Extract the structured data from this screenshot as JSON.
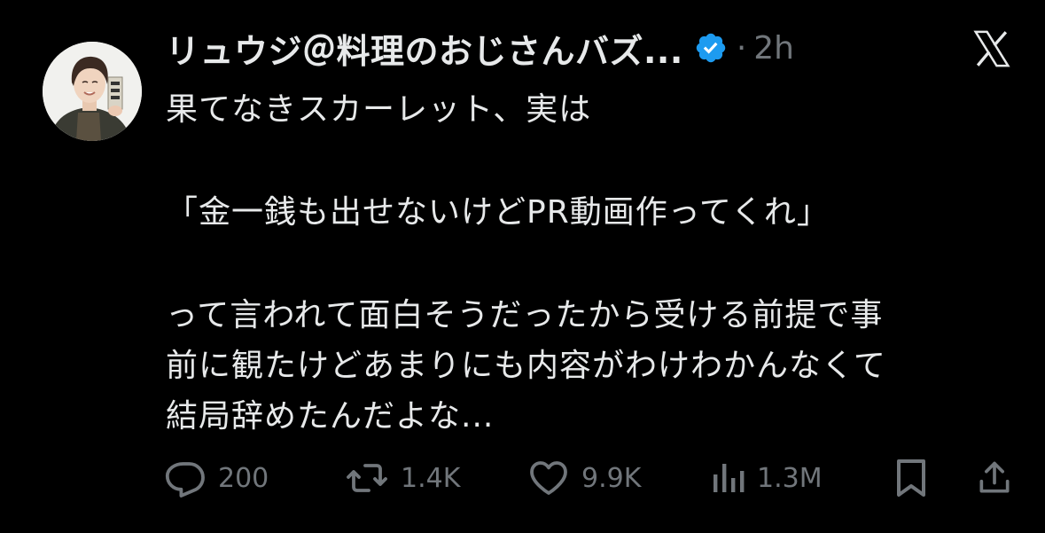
{
  "tweet": {
    "author": {
      "display_name": "リュウジ＠料理のおじさんバズ...",
      "verified_icon": "verified-badge-icon",
      "avatar_icon": "avatar-photo"
    },
    "separator": "·",
    "time": "2h",
    "brand_icon": "x-logo-icon",
    "lines": [
      "果てなきスカーレット、実は",
      "「金一銭も出せないけどPR動画作ってくれ」",
      "って言われて面白そうだったから受ける前提で事",
      "前に観たけどあまりにも内容がわけわかんなくて",
      "結局辞めたんだよな..."
    ]
  },
  "actions": {
    "reply": {
      "icon": "reply-icon",
      "count": "200"
    },
    "retweet": {
      "icon": "retweet-icon",
      "count": "1.4K"
    },
    "like": {
      "icon": "heart-icon",
      "count": "9.9K"
    },
    "views": {
      "icon": "views-chart-icon",
      "count": "1.3M"
    },
    "bookmark": {
      "icon": "bookmark-icon"
    },
    "share": {
      "icon": "share-icon"
    }
  },
  "colors": {
    "background": "#000000",
    "text": "#e7e9ea",
    "secondary": "#71767b",
    "verified": "#1d9bf0"
  }
}
